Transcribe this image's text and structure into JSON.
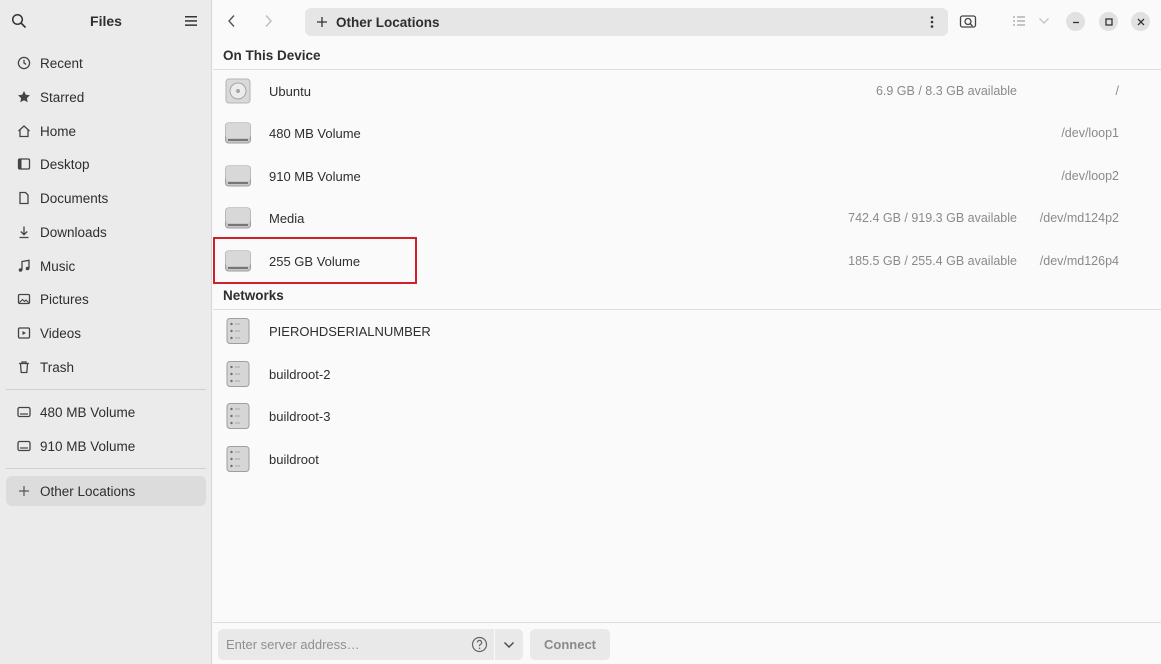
{
  "app": {
    "title": "Files"
  },
  "sidebar": {
    "items": [
      {
        "label": "Recent",
        "icon": "clock-icon"
      },
      {
        "label": "Starred",
        "icon": "star-icon"
      },
      {
        "label": "Home",
        "icon": "home-icon"
      },
      {
        "label": "Desktop",
        "icon": "desktop-icon"
      },
      {
        "label": "Documents",
        "icon": "documents-icon"
      },
      {
        "label": "Downloads",
        "icon": "downloads-icon"
      },
      {
        "label": "Music",
        "icon": "music-icon"
      },
      {
        "label": "Pictures",
        "icon": "pictures-icon"
      },
      {
        "label": "Videos",
        "icon": "videos-icon"
      },
      {
        "label": "Trash",
        "icon": "trash-icon"
      }
    ],
    "volumes": [
      {
        "label": "480 MB Volume",
        "icon": "drive-icon"
      },
      {
        "label": "910 MB Volume",
        "icon": "drive-icon"
      }
    ],
    "other_locations": {
      "label": "Other Locations",
      "icon": "plus-icon"
    }
  },
  "header": {
    "path_label": "Other Locations"
  },
  "sections": {
    "device_title": "On This Device",
    "network_title": "Networks"
  },
  "devices": [
    {
      "name": "Ubuntu",
      "available": "6.9 GB / 8.3 GB available",
      "path": "/",
      "icon": "disc-icon"
    },
    {
      "name": "480 MB Volume",
      "available": "",
      "path": "/dev/loop1",
      "icon": "drive-icon"
    },
    {
      "name": "910 MB Volume",
      "available": "",
      "path": "/dev/loop2",
      "icon": "drive-icon"
    },
    {
      "name": "Media",
      "available": "742.4 GB / 919.3 GB available",
      "path": "/dev/md124p2",
      "icon": "drive-icon"
    },
    {
      "name": "255 GB Volume",
      "available": "185.5 GB / 255.4 GB available",
      "path": "/dev/md126p4",
      "icon": "drive-icon"
    }
  ],
  "networks": [
    {
      "name": "PIEROHDSERIALNUMBER",
      "icon": "server-icon"
    },
    {
      "name": "buildroot-2",
      "icon": "server-icon"
    },
    {
      "name": "buildroot-3",
      "icon": "server-icon"
    },
    {
      "name": "buildroot",
      "icon": "server-icon"
    }
  ],
  "footer": {
    "server_placeholder": "Enter server address…",
    "connect_label": "Connect"
  },
  "colors": {
    "highlight": "#d0202a",
    "sidebar_bg": "#ebebeb",
    "content_bg": "#fafafa"
  }
}
